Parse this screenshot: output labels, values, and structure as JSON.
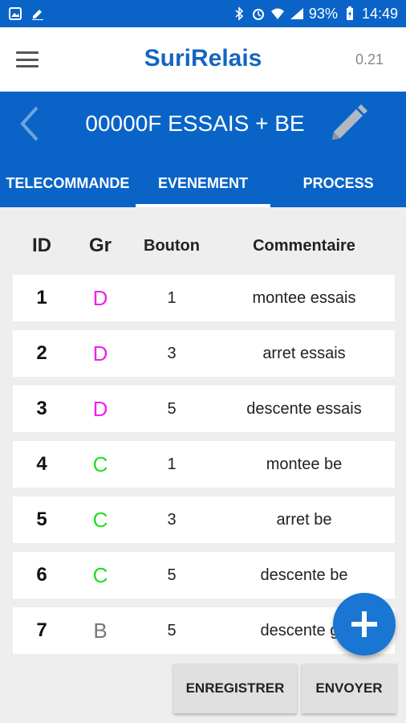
{
  "status_bar": {
    "battery": "93%",
    "time": "14:49"
  },
  "app_bar": {
    "title": "SuriRelais",
    "version": "0.21"
  },
  "banner": {
    "title": "00000F ESSAIS + BE"
  },
  "tabs": [
    {
      "label": "TELECOMMANDE",
      "active": false
    },
    {
      "label": "EVENEMENT",
      "active": true
    },
    {
      "label": "PROCESS",
      "active": false
    }
  ],
  "table": {
    "headers": {
      "id": "ID",
      "gr": "Gr",
      "bouton": "Bouton",
      "commentaire": "Commentaire"
    },
    "rows": [
      {
        "id": "1",
        "gr": "D",
        "gr_color": "#ee22ee",
        "bouton": "1",
        "commentaire": "montee essais"
      },
      {
        "id": "2",
        "gr": "D",
        "gr_color": "#ee22ee",
        "bouton": "3",
        "commentaire": "arret essais"
      },
      {
        "id": "3",
        "gr": "D",
        "gr_color": "#ee22ee",
        "bouton": "5",
        "commentaire": "descente essais"
      },
      {
        "id": "4",
        "gr": "C",
        "gr_color": "#22dd22",
        "bouton": "1",
        "commentaire": "montee be"
      },
      {
        "id": "5",
        "gr": "C",
        "gr_color": "#22dd22",
        "bouton": "3",
        "commentaire": "arret be"
      },
      {
        "id": "6",
        "gr": "C",
        "gr_color": "#22dd22",
        "bouton": "5",
        "commentaire": "descente be"
      },
      {
        "id": "7",
        "gr": "B",
        "gr_color": "#777777",
        "bouton": "5",
        "commentaire": "descente ge"
      }
    ]
  },
  "buttons": {
    "save": "ENREGISTRER",
    "send": "ENVOYER"
  },
  "colors": {
    "primary": "#0a64c8",
    "title": "#1565c0",
    "fab": "#1976d2"
  },
  "icons": {
    "menu": "hamburger-icon",
    "back": "chevron-left-icon",
    "edit": "pencil-icon",
    "add": "plus-icon"
  }
}
